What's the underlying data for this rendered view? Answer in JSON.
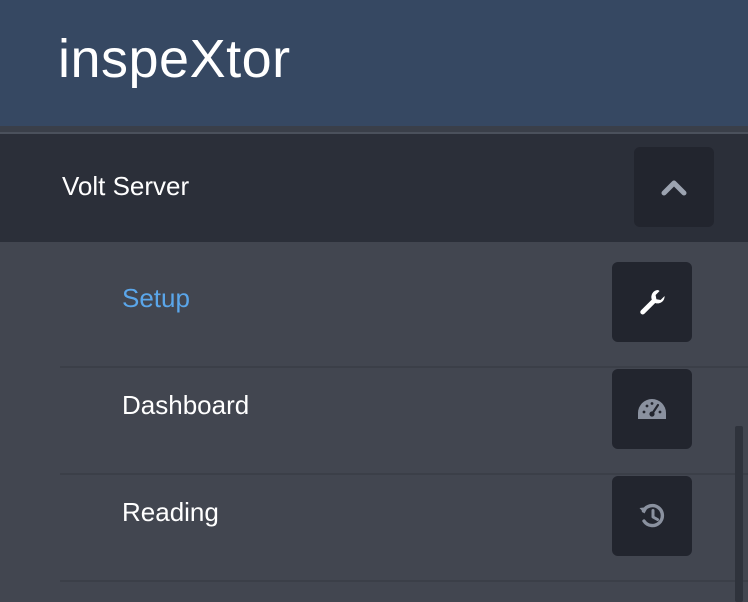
{
  "app": {
    "title": "inspeXtor"
  },
  "section": {
    "title": "Volt Server",
    "toggle_icon": "chevron-up-icon"
  },
  "menu": {
    "items": [
      {
        "label": "Setup",
        "icon": "wrench-icon",
        "active": true
      },
      {
        "label": "Dashboard",
        "icon": "dashboard-icon",
        "active": false
      },
      {
        "label": "Reading",
        "icon": "history-icon",
        "active": false
      }
    ]
  },
  "colors": {
    "header_bg": "#364862",
    "section_bg": "#2b2f39",
    "menu_bg": "#424650",
    "button_bg": "#22252e",
    "active_text": "#5aa6ea",
    "icon_muted": "#8a919f"
  }
}
